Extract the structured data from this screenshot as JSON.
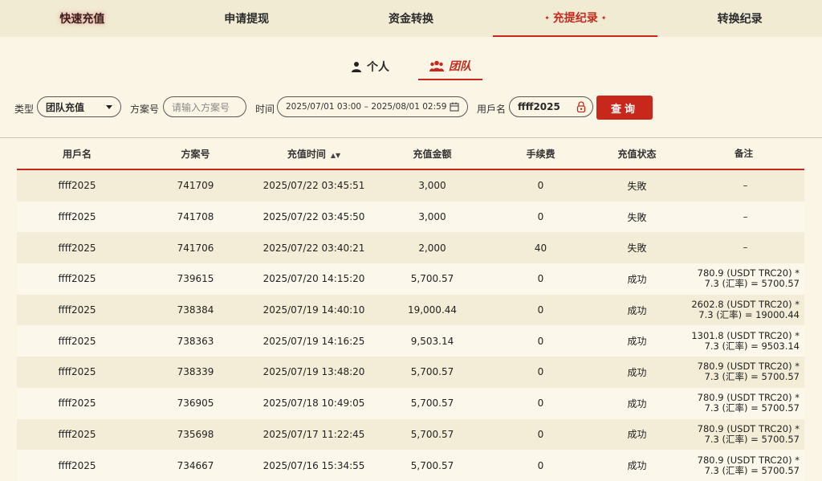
{
  "nav": {
    "tabs": [
      {
        "label": "快速充值",
        "active": false
      },
      {
        "label": "申请提现",
        "active": false
      },
      {
        "label": "资金转换",
        "active": false
      },
      {
        "label": "充提纪录",
        "active": true
      },
      {
        "label": "转换纪录",
        "active": false
      }
    ]
  },
  "subtabs": [
    {
      "label": "个人",
      "icon": "person-icon",
      "active": false
    },
    {
      "label": "团队",
      "icon": "team-icon",
      "active": true
    }
  ],
  "filters": {
    "type_label": "类型",
    "type_value": "团队充值",
    "plan_label": "方案号",
    "plan_placeholder": "请输入方案号",
    "time_label": "时间",
    "date_start": "2025/07/01 03:00",
    "date_sep": "–",
    "date_end": "2025/08/01 02:59",
    "user_label": "用戶名",
    "user_value": "ffff2025",
    "query_button": "查询"
  },
  "table": {
    "headers": [
      "用戶名",
      "方案号",
      "充值时间",
      "充值金额",
      "手续费",
      "充值状态",
      "备注"
    ],
    "rows": [
      {
        "user": "ffff2025",
        "plan": "741709",
        "time": "2025/07/22 03:45:51",
        "amount": "3,000",
        "fee": "0",
        "status": "失敗",
        "note1": "–",
        "note2": ""
      },
      {
        "user": "ffff2025",
        "plan": "741708",
        "time": "2025/07/22 03:45:50",
        "amount": "3,000",
        "fee": "0",
        "status": "失敗",
        "note1": "–",
        "note2": ""
      },
      {
        "user": "ffff2025",
        "plan": "741706",
        "time": "2025/07/22 03:40:21",
        "amount": "2,000",
        "fee": "40",
        "status": "失敗",
        "note1": "–",
        "note2": ""
      },
      {
        "user": "ffff2025",
        "plan": "739615",
        "time": "2025/07/20 14:15:20",
        "amount": "5,700.57",
        "fee": "0",
        "status": "成功",
        "note1": "780.9 (USDT TRC20) *",
        "note2": "7.3 (汇率) = 5700.57"
      },
      {
        "user": "ffff2025",
        "plan": "738384",
        "time": "2025/07/19 14:40:10",
        "amount": "19,000.44",
        "fee": "0",
        "status": "成功",
        "note1": "2602.8 (USDT TRC20) *",
        "note2": "7.3 (汇率) = 19000.44"
      },
      {
        "user": "ffff2025",
        "plan": "738363",
        "time": "2025/07/19 14:16:25",
        "amount": "9,503.14",
        "fee": "0",
        "status": "成功",
        "note1": "1301.8 (USDT TRC20) *",
        "note2": "7.3 (汇率) = 9503.14"
      },
      {
        "user": "ffff2025",
        "plan": "738339",
        "time": "2025/07/19 13:48:20",
        "amount": "5,700.57",
        "fee": "0",
        "status": "成功",
        "note1": "780.9 (USDT TRC20) *",
        "note2": "7.3 (汇率) = 5700.57"
      },
      {
        "user": "ffff2025",
        "plan": "736905",
        "time": "2025/07/18 10:49:05",
        "amount": "5,700.57",
        "fee": "0",
        "status": "成功",
        "note1": "780.9 (USDT TRC20) *",
        "note2": "7.3 (汇率) = 5700.57"
      },
      {
        "user": "ffff2025",
        "plan": "735698",
        "time": "2025/07/17 11:22:45",
        "amount": "5,700.57",
        "fee": "0",
        "status": "成功",
        "note1": "780.9 (USDT TRC20) *",
        "note2": "7.3 (汇率) = 5700.57"
      },
      {
        "user": "ffff2025",
        "plan": "734667",
        "time": "2025/07/16 15:34:55",
        "amount": "5,700.57",
        "fee": "0",
        "status": "成功",
        "note1": "780.9 (USDT TRC20) *",
        "note2": "7.3 (汇率) = 5700.57"
      }
    ]
  },
  "colors": {
    "accent": "#c8281c",
    "background": "#faf5e4",
    "row_alt": "#f3ecd6"
  }
}
